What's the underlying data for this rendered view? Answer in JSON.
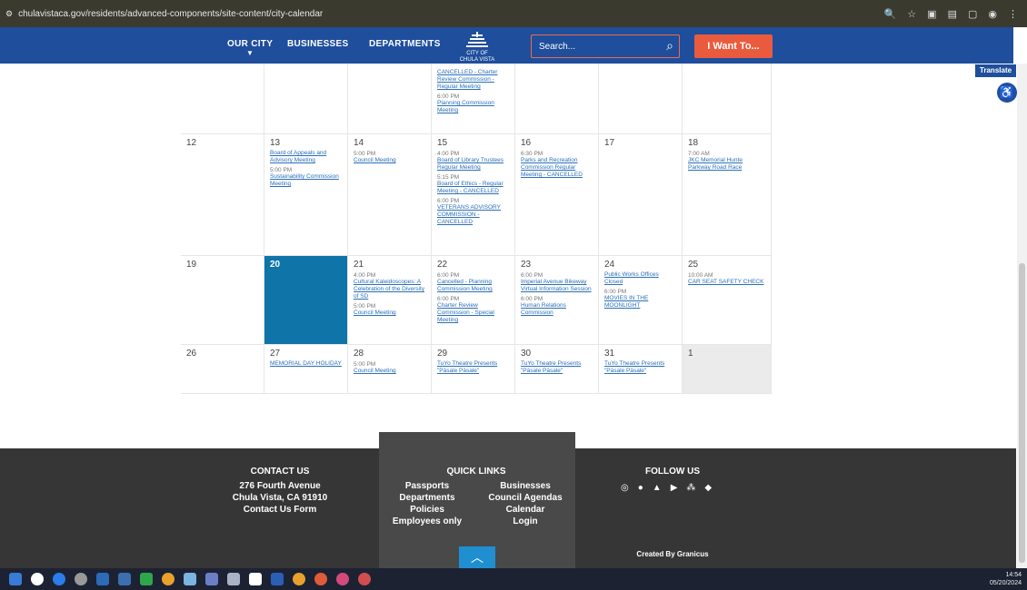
{
  "browser": {
    "url": "chulavistaca.gov/residents/advanced-components/site-content/city-calendar"
  },
  "nav": {
    "our_city": "OUR CITY",
    "businesses": "BUSINESSES",
    "departments": "DEPARTMENTS",
    "logo_text": "CITY OF CHULA VISTA",
    "search_placeholder": "Search...",
    "i_want": "I Want To...",
    "translate": "Translate"
  },
  "calendar": {
    "prev_week": {
      "c2": [
        "CANCELLED - Charter Review Commission - Regular Meeting"
      ],
      "c2_time2": "6:00 PM",
      "c2_link2": "Planning Commission Meeting"
    },
    "week1": {
      "d12": "12",
      "d13": "13",
      "e13a": "Board of Appeals and Advisory Meeting",
      "t13b": "5:00 PM",
      "e13b": "Sustainability Commission Meeting",
      "d14": "14",
      "t14": "5:00 PM",
      "e14": "Council Meeting",
      "d15": "15",
      "t15a": "4:00 PM",
      "e15a": "Board of Library Trustees Regular Meeting",
      "t15b": "5:15 PM",
      "e15b": "Board of Ethics - Regular Meeting - CANCELLED",
      "t15c": "6:00 PM",
      "e15c": "VETERANS ADVISORY COMMISSION - CANCELLED",
      "d16": "16",
      "t16": "6:30 PM",
      "e16": "Parks and Recreation Commission Regular Meeting - CANCELLED",
      "d17": "17",
      "d18": "18",
      "t18": "7:00 AM",
      "e18": "JKC Memorial Hunte Parkway Road Race"
    },
    "week2": {
      "d19": "19",
      "d20": "20",
      "d21": "21",
      "t21a": "4:00 PM",
      "e21a": "Cultural Kaleidoscopes: A Celebration of the Diversity of SD",
      "t21b": "5:00 PM",
      "e21b": "Council Meeting",
      "d22": "22",
      "t22a": "6:00 PM",
      "e22a": "Cancelled - Planning Commission Meeting",
      "t22b": "6:00 PM",
      "e22b": "Charter Review Commission - Special Meeting",
      "d23": "23",
      "t23a": "6:00 PM",
      "e23a": "Imperial Avenue Bikeway Virtual Information Session",
      "t23b": "6:00 PM",
      "e23b": "Human Relations Commission",
      "d24": "24",
      "e24a": "Public Works Offices Closed",
      "t24b": "6:00 PM",
      "e24b": "MOVIES IN THE MOONLIGHT",
      "d25": "25",
      "t25": "10:00 AM",
      "e25": "CAR SEAT SAFETY CHECK"
    },
    "week3": {
      "d26": "26",
      "d27": "27",
      "e27": "MEMORIAL DAY HOLIDAY",
      "d28": "28",
      "t28": "5:00 PM",
      "e28": "Council Meeting",
      "d29": "29",
      "e29": "TuYo Theatre Presents \"Pāsale Pāsale\"",
      "d30": "30",
      "e30": "TuYo Theatre Presents \"Pāsale Pāsale\"",
      "d31": "31",
      "e31": "TuYo Theatre Presents \"Pāsale Pāsale\"",
      "d1": "1"
    }
  },
  "footer": {
    "contact_title": "CONTACT US",
    "address1": "276 Fourth Avenue",
    "address2": "Chula Vista, CA 91910",
    "contact_form": "Contact Us Form",
    "quick_title": "QUICK LINKS",
    "ql": [
      "Passports",
      "Businesses",
      "Departments",
      "Council Agendas",
      "Policies",
      "Calendar",
      "Employees only",
      "Login"
    ],
    "follow_title": "FOLLOW US",
    "credit": "Created By Granicus"
  },
  "taskbar": {
    "time": "14:54",
    "date": "05/20/2024"
  }
}
